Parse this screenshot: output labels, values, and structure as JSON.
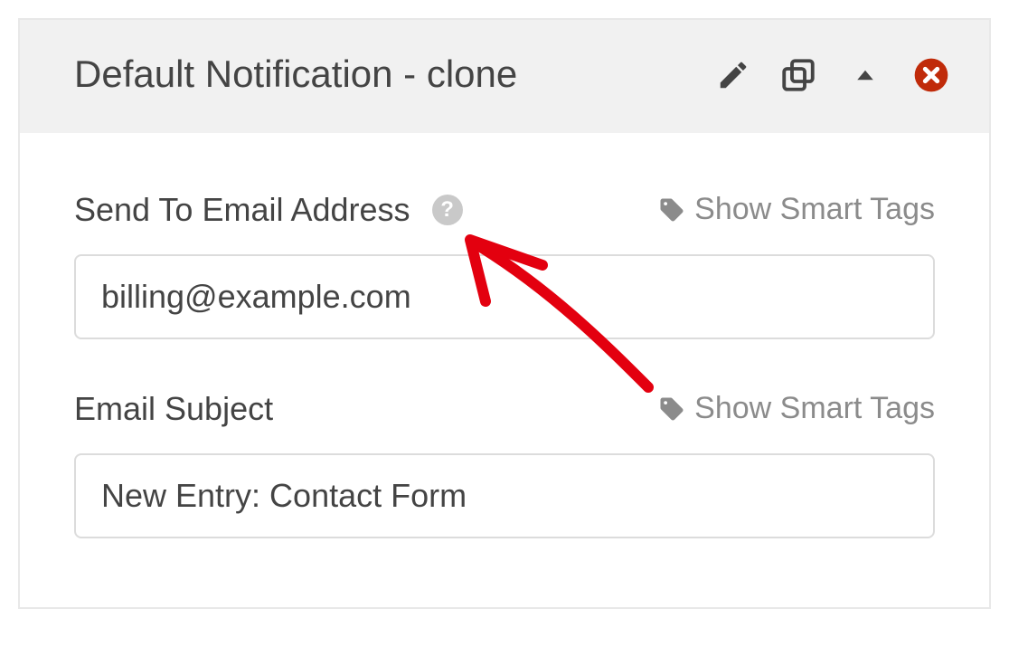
{
  "header": {
    "title": "Default Notification - clone"
  },
  "fields": {
    "sendTo": {
      "label": "Send To Email Address",
      "value": "billing@example.com",
      "smartTagsLabel": "Show Smart Tags"
    },
    "subject": {
      "label": "Email Subject",
      "value": "New Entry: Contact Form",
      "smartTagsLabel": "Show Smart Tags"
    }
  },
  "help": {
    "glyph": "?"
  },
  "colors": {
    "delete": "#c02b0a",
    "icon": "#444444",
    "arrow": "#e3000f"
  }
}
